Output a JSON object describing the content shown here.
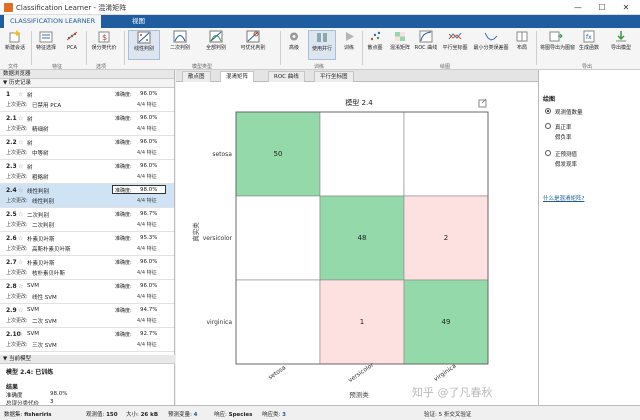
{
  "window": {
    "title": "Classification Learner - 混淆矩阵",
    "minimize": "—",
    "maximize": "☐",
    "close": "✕"
  },
  "tabs": [
    {
      "label": "CLASSIFICATION LEARNER",
      "active": true
    },
    {
      "label": "视图",
      "active": false
    }
  ],
  "ribbon": {
    "buttons": [
      {
        "label": "新建会话",
        "icon": "new-session-icon"
      },
      {
        "label": "特征选择",
        "icon": "feature-select-icon"
      },
      {
        "label": "PCA",
        "icon": "pca-icon"
      },
      {
        "label": "误分类代价",
        "icon": "cost-icon"
      },
      {
        "label": "线性判别",
        "icon": "linear-discriminant-icon"
      },
      {
        "label": "二次判别",
        "icon": "quadratic-discriminant-icon"
      },
      {
        "label": "全部判别",
        "icon": "all-discriminant-icon"
      },
      {
        "label": "可优化判别",
        "icon": "optimizable-discriminant-icon"
      },
      {
        "label": "高级",
        "icon": "advanced-icon"
      },
      {
        "label": "使用并行",
        "icon": "parallel-icon"
      },
      {
        "label": "训练",
        "icon": "train-icon"
      },
      {
        "label": "散点图",
        "icon": "scatter-icon"
      },
      {
        "label": "混淆矩阵",
        "icon": "confusion-icon"
      },
      {
        "label": "ROC 曲线",
        "icon": "roc-icon"
      },
      {
        "label": "平行坐标图",
        "icon": "parallel-coords-icon"
      },
      {
        "label": "最小分类误差图",
        "icon": "min-error-icon"
      },
      {
        "label": "布局",
        "icon": "layout-icon"
      },
      {
        "label": "将图导出为图窗",
        "icon": "export-plot-icon"
      },
      {
        "label": "生成函数",
        "icon": "generate-function-icon"
      },
      {
        "label": "导出模型",
        "icon": "export-model-icon"
      }
    ],
    "groups": [
      "文件",
      "特征",
      "选项",
      "模型类型",
      "训练",
      "绘图",
      "导出"
    ]
  },
  "left": {
    "browser_title": "数据浏览器",
    "history_title": "▼ 历史记录",
    "acc_label": "准确度:",
    "change_label": "上次更改:",
    "models": [
      {
        "num": "1",
        "name": "树",
        "acc": "96.0%",
        "change": "已禁用 PCA",
        "feat": "4/4 特征"
      },
      {
        "num": "2.1",
        "name": "树",
        "acc": "96.0%",
        "change": "精细树",
        "feat": "4/4 特征"
      },
      {
        "num": "2.2",
        "name": "树",
        "acc": "96.0%",
        "change": "中等树",
        "feat": "4/4 特征"
      },
      {
        "num": "2.3",
        "name": "树",
        "acc": "96.0%",
        "change": "粗略树",
        "feat": "4/4 特征"
      },
      {
        "num": "2.4",
        "name": "线性判别",
        "acc": "98.0%",
        "change": "线性判别",
        "feat": "4/4 特征"
      },
      {
        "num": "2.5",
        "name": "二次判别",
        "acc": "96.7%",
        "change": "二次判别",
        "feat": "4/4 特征"
      },
      {
        "num": "2.6",
        "name": "朴素贝叶斯",
        "acc": "95.3%",
        "change": "高斯朴素贝叶斯",
        "feat": "4/4 特征"
      },
      {
        "num": "2.7",
        "name": "朴素贝叶斯",
        "acc": "96.0%",
        "change": "核朴素贝叶斯",
        "feat": "4/4 特征"
      },
      {
        "num": "2.8",
        "name": "SVM",
        "acc": "96.0%",
        "change": "线性 SVM",
        "feat": "4/4 特征"
      },
      {
        "num": "2.9",
        "name": "SVM",
        "acc": "94.7%",
        "change": "二次 SVM",
        "feat": "4/4 特征"
      },
      {
        "num": "2.10",
        "name": "SVM",
        "acc": "92.7%",
        "change": "三次 SVM",
        "feat": "4/4 特征"
      }
    ],
    "current_title": "▼ 当前模型",
    "current_model": "模型 2.4: 已训练",
    "result_title": "结果",
    "result_acc_label": "准确度",
    "result_acc_value": "98.0%",
    "total_cost_label": "总误分类代价",
    "total_cost_value": "3"
  },
  "doc_tabs": [
    "散点图",
    "混淆矩阵",
    "ROC 曲线",
    "平行坐标图"
  ],
  "plot": {
    "title": "模型 2.4",
    "ylabel": "真实类",
    "xlabel": "预测类",
    "classes": [
      "setosa",
      "versicolor",
      "virginica"
    ],
    "matrix": [
      [
        50,
        0,
        0
      ],
      [
        0,
        48,
        2
      ],
      [
        0,
        1,
        49
      ]
    ],
    "diag_color": "#93d9a9",
    "off_color": "#fde0e0",
    "empty_color": "#ffffff"
  },
  "right_panel": {
    "draw_title": "绘图",
    "options": [
      {
        "label": "观测值数量",
        "selected": true
      },
      {
        "label": "真正率",
        "selected": false
      },
      {
        "label": "假负率",
        "selected": false
      },
      {
        "label": "正预测值",
        "selected": false
      },
      {
        "label": "假发现率",
        "selected": false
      }
    ],
    "link": "什么是混淆矩阵?"
  },
  "statusbar": {
    "dataset_label": "数据集:",
    "dataset": "fisheriris",
    "obs_label": "观测值:",
    "obs": "150",
    "size_label": "大小:",
    "size": "26 kB",
    "pred_label": "预测变量:",
    "pred": "4",
    "resp_label": "响应:",
    "resp": "Species",
    "classes_label": "响应类:",
    "classes": "3",
    "validation": "验证: 5 折交叉验证"
  },
  "watermark": "知乎 @了凡春秋"
}
